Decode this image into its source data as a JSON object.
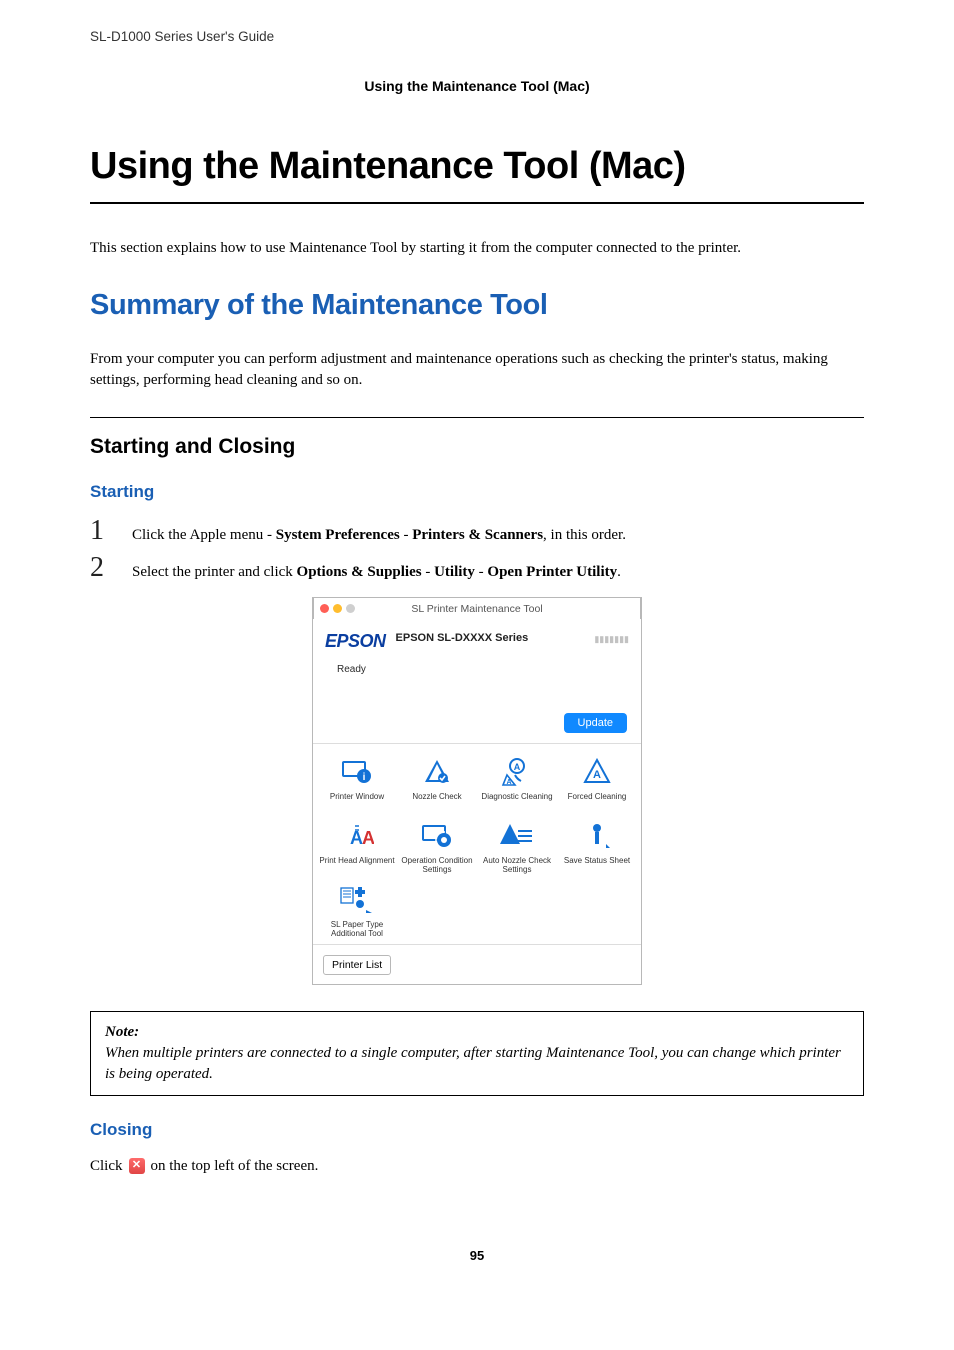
{
  "runningHeader": "SL-D1000 Series User's Guide",
  "docSectionLabel": "Using the Maintenance Tool (Mac)",
  "h1": "Using the Maintenance Tool (Mac)",
  "intro": "This section explains how to use Maintenance Tool by starting it from the computer connected to the printer.",
  "h2": "Summary of the Maintenance Tool",
  "summaryPara": "From your computer you can perform adjustment and maintenance operations such as checking the printer's status, making settings, performing head cleaning and so on.",
  "h3_startclose": "Starting and Closing",
  "h4_starting": "Starting",
  "steps": [
    {
      "num": "1",
      "pre": "Click the Apple menu - ",
      "b1": "System Preferences",
      "mid1": " - ",
      "b2": "Printers & Scanners",
      "post": ", in this order."
    },
    {
      "num": "2",
      "pre": "Select the printer and click ",
      "b1": "Options & Supplies",
      "mid1": " - ",
      "b2": "Utility",
      "mid2": " - ",
      "b3": "Open Printer Utility",
      "post": "."
    }
  ],
  "app": {
    "titlebar": "SL Printer Maintenance Tool",
    "logo": "EPSON",
    "model": "EPSON SL-DXXXX Series",
    "status": "Ready",
    "updateBtn": "Update",
    "tiles": {
      "printerWindow": "Printer Window",
      "nozzleCheck": "Nozzle Check",
      "diagnosticCleaning": "Diagnostic Cleaning",
      "forcedCleaning": "Forced Cleaning",
      "printHeadAlignment": "Print Head Alignment",
      "operationConditionSettings": "Operation Condition Settings",
      "autoNozzleCheckSettings": "Auto Nozzle Check Settings",
      "saveStatusSheet": "Save Status Sheet",
      "slPaperTypeAdditionalTool": "SL Paper Type Additional Tool"
    },
    "printerListBtn": "Printer List"
  },
  "note": {
    "label": "Note:",
    "body": "When multiple printers are connected to a single computer, after starting Maintenance Tool, you can change which printer is being operated."
  },
  "h4_closing": "Closing",
  "closingPre": "Click ",
  "closingPost": " on the top left of the screen.",
  "pageNumber": "95"
}
